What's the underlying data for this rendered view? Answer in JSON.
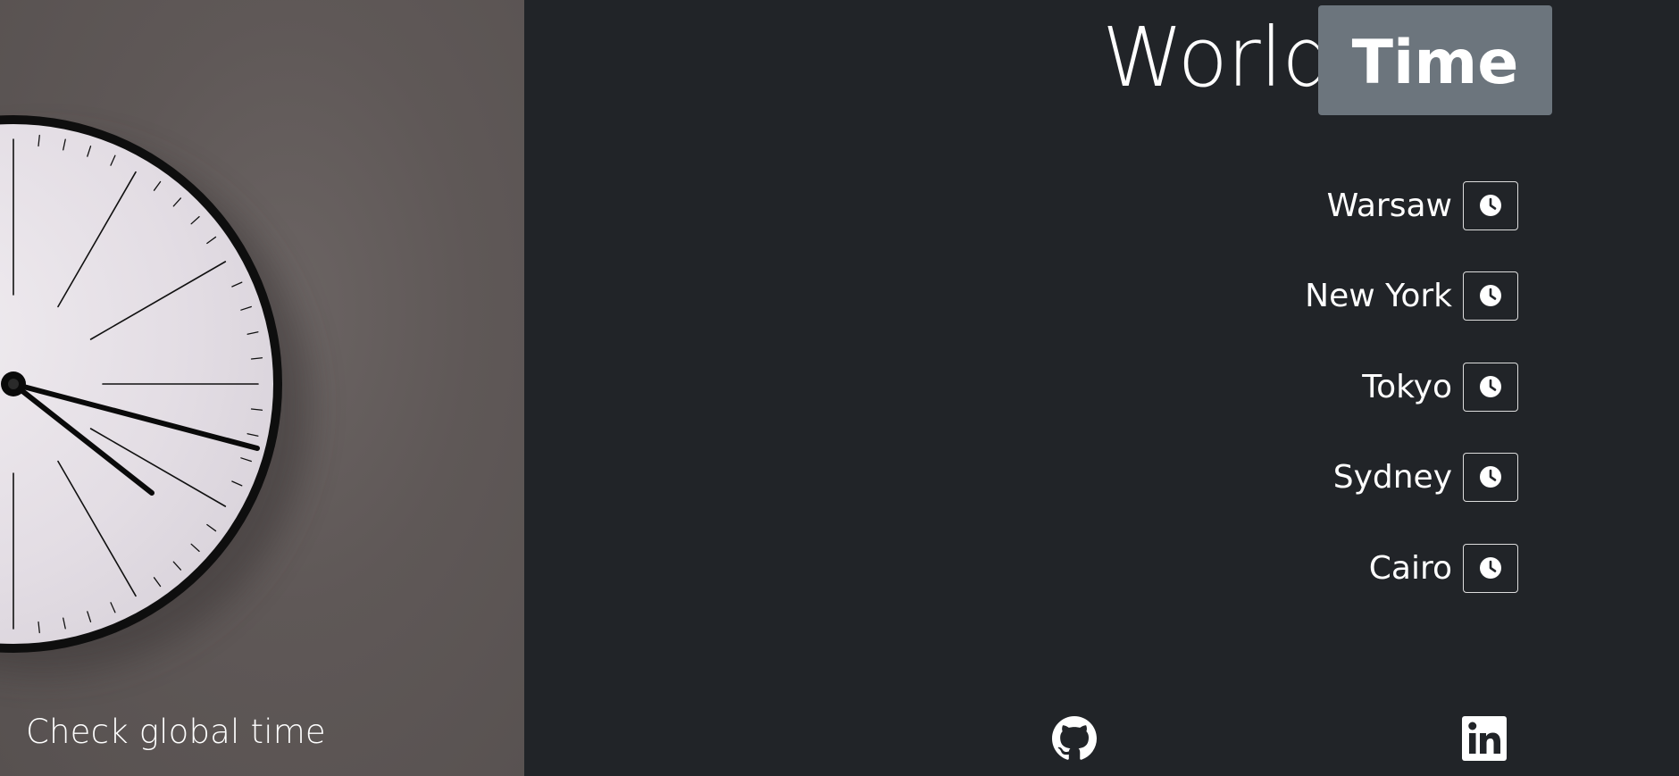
{
  "sidebar": {
    "tagline": "Check global time",
    "hero_image": "wall-clock-photo"
  },
  "header": {
    "title_light": "World",
    "title_badge": "Time"
  },
  "cities": [
    {
      "label": "Warsaw",
      "icon": "clock-icon"
    },
    {
      "label": "New York",
      "icon": "clock-icon"
    },
    {
      "label": "Tokyo",
      "icon": "clock-icon"
    },
    {
      "label": "Sydney",
      "icon": "clock-icon"
    },
    {
      "label": "Cairo",
      "icon": "clock-icon"
    }
  ],
  "footer": {
    "links": [
      {
        "icon": "github-icon"
      },
      {
        "icon": "linkedin-icon"
      }
    ]
  },
  "colors": {
    "background": "#212428",
    "badge": "#6c757d",
    "text": "#ffffff"
  }
}
